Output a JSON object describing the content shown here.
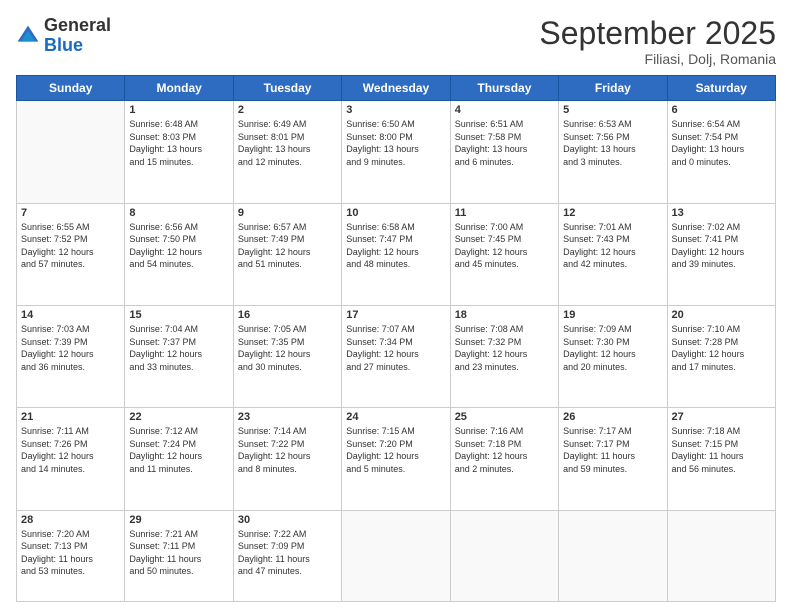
{
  "logo": {
    "general": "General",
    "blue": "Blue"
  },
  "header": {
    "month": "September 2025",
    "location": "Filiasi, Dolj, Romania"
  },
  "weekdays": [
    "Sunday",
    "Monday",
    "Tuesday",
    "Wednesday",
    "Thursday",
    "Friday",
    "Saturday"
  ],
  "weeks": [
    [
      {
        "day": "",
        "info": ""
      },
      {
        "day": "1",
        "info": "Sunrise: 6:48 AM\nSunset: 8:03 PM\nDaylight: 13 hours\nand 15 minutes."
      },
      {
        "day": "2",
        "info": "Sunrise: 6:49 AM\nSunset: 8:01 PM\nDaylight: 13 hours\nand 12 minutes."
      },
      {
        "day": "3",
        "info": "Sunrise: 6:50 AM\nSunset: 8:00 PM\nDaylight: 13 hours\nand 9 minutes."
      },
      {
        "day": "4",
        "info": "Sunrise: 6:51 AM\nSunset: 7:58 PM\nDaylight: 13 hours\nand 6 minutes."
      },
      {
        "day": "5",
        "info": "Sunrise: 6:53 AM\nSunset: 7:56 PM\nDaylight: 13 hours\nand 3 minutes."
      },
      {
        "day": "6",
        "info": "Sunrise: 6:54 AM\nSunset: 7:54 PM\nDaylight: 13 hours\nand 0 minutes."
      }
    ],
    [
      {
        "day": "7",
        "info": "Sunrise: 6:55 AM\nSunset: 7:52 PM\nDaylight: 12 hours\nand 57 minutes."
      },
      {
        "day": "8",
        "info": "Sunrise: 6:56 AM\nSunset: 7:50 PM\nDaylight: 12 hours\nand 54 minutes."
      },
      {
        "day": "9",
        "info": "Sunrise: 6:57 AM\nSunset: 7:49 PM\nDaylight: 12 hours\nand 51 minutes."
      },
      {
        "day": "10",
        "info": "Sunrise: 6:58 AM\nSunset: 7:47 PM\nDaylight: 12 hours\nand 48 minutes."
      },
      {
        "day": "11",
        "info": "Sunrise: 7:00 AM\nSunset: 7:45 PM\nDaylight: 12 hours\nand 45 minutes."
      },
      {
        "day": "12",
        "info": "Sunrise: 7:01 AM\nSunset: 7:43 PM\nDaylight: 12 hours\nand 42 minutes."
      },
      {
        "day": "13",
        "info": "Sunrise: 7:02 AM\nSunset: 7:41 PM\nDaylight: 12 hours\nand 39 minutes."
      }
    ],
    [
      {
        "day": "14",
        "info": "Sunrise: 7:03 AM\nSunset: 7:39 PM\nDaylight: 12 hours\nand 36 minutes."
      },
      {
        "day": "15",
        "info": "Sunrise: 7:04 AM\nSunset: 7:37 PM\nDaylight: 12 hours\nand 33 minutes."
      },
      {
        "day": "16",
        "info": "Sunrise: 7:05 AM\nSunset: 7:35 PM\nDaylight: 12 hours\nand 30 minutes."
      },
      {
        "day": "17",
        "info": "Sunrise: 7:07 AM\nSunset: 7:34 PM\nDaylight: 12 hours\nand 27 minutes."
      },
      {
        "day": "18",
        "info": "Sunrise: 7:08 AM\nSunset: 7:32 PM\nDaylight: 12 hours\nand 23 minutes."
      },
      {
        "day": "19",
        "info": "Sunrise: 7:09 AM\nSunset: 7:30 PM\nDaylight: 12 hours\nand 20 minutes."
      },
      {
        "day": "20",
        "info": "Sunrise: 7:10 AM\nSunset: 7:28 PM\nDaylight: 12 hours\nand 17 minutes."
      }
    ],
    [
      {
        "day": "21",
        "info": "Sunrise: 7:11 AM\nSunset: 7:26 PM\nDaylight: 12 hours\nand 14 minutes."
      },
      {
        "day": "22",
        "info": "Sunrise: 7:12 AM\nSunset: 7:24 PM\nDaylight: 12 hours\nand 11 minutes."
      },
      {
        "day": "23",
        "info": "Sunrise: 7:14 AM\nSunset: 7:22 PM\nDaylight: 12 hours\nand 8 minutes."
      },
      {
        "day": "24",
        "info": "Sunrise: 7:15 AM\nSunset: 7:20 PM\nDaylight: 12 hours\nand 5 minutes."
      },
      {
        "day": "25",
        "info": "Sunrise: 7:16 AM\nSunset: 7:18 PM\nDaylight: 12 hours\nand 2 minutes."
      },
      {
        "day": "26",
        "info": "Sunrise: 7:17 AM\nSunset: 7:17 PM\nDaylight: 11 hours\nand 59 minutes."
      },
      {
        "day": "27",
        "info": "Sunrise: 7:18 AM\nSunset: 7:15 PM\nDaylight: 11 hours\nand 56 minutes."
      }
    ],
    [
      {
        "day": "28",
        "info": "Sunrise: 7:20 AM\nSunset: 7:13 PM\nDaylight: 11 hours\nand 53 minutes."
      },
      {
        "day": "29",
        "info": "Sunrise: 7:21 AM\nSunset: 7:11 PM\nDaylight: 11 hours\nand 50 minutes."
      },
      {
        "day": "30",
        "info": "Sunrise: 7:22 AM\nSunset: 7:09 PM\nDaylight: 11 hours\nand 47 minutes."
      },
      {
        "day": "",
        "info": ""
      },
      {
        "day": "",
        "info": ""
      },
      {
        "day": "",
        "info": ""
      },
      {
        "day": "",
        "info": ""
      }
    ]
  ]
}
